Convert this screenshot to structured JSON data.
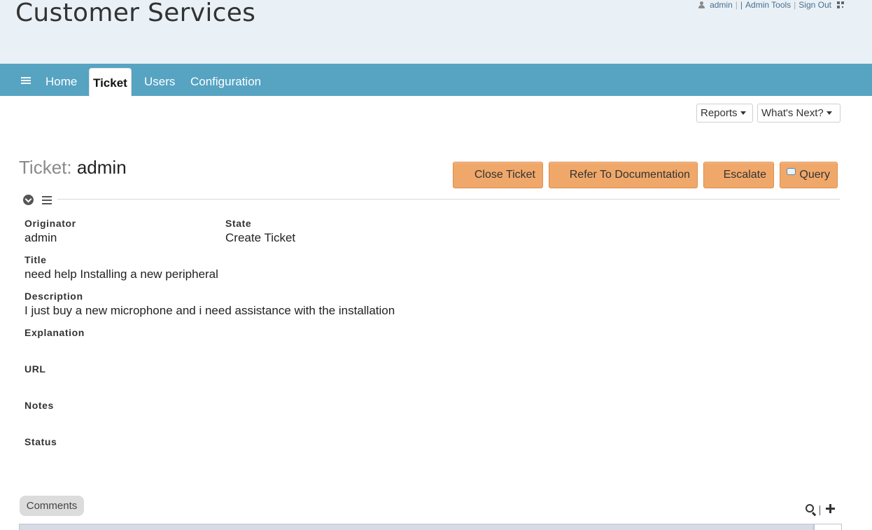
{
  "header": {
    "app_title": "Customer Services",
    "user": "admin",
    "separator": "|",
    "empty_link": "|",
    "admin_tools": "Admin Tools",
    "sign_out": "Sign Out"
  },
  "nav": {
    "items": [
      {
        "label": "Home",
        "active": false
      },
      {
        "label": "Ticket",
        "active": true
      },
      {
        "label": "Users",
        "active": false
      },
      {
        "label": "Configuration",
        "active": false
      }
    ]
  },
  "toolbar": {
    "reports": "Reports",
    "whats_next": "What's Next?"
  },
  "ticket": {
    "heading_label": "Ticket:",
    "heading_value": "admin",
    "actions": {
      "close": "Close Ticket",
      "refer": "Refer To Documentation",
      "escalate": "Escalate",
      "query": "Query"
    },
    "fields": {
      "originator": {
        "label": "Originator",
        "value": "admin"
      },
      "state": {
        "label": "State",
        "value": "Create Ticket"
      },
      "title": {
        "label": "Title",
        "value": "need help Installing a new peripheral"
      },
      "description": {
        "label": "Description",
        "value": "I just buy a new microphone and i need assistance with the installation"
      },
      "explanation": {
        "label": "Explanation",
        "value": ""
      },
      "url": {
        "label": "URL",
        "value": ""
      },
      "notes": {
        "label": "Notes",
        "value": ""
      },
      "status": {
        "label": "Status",
        "value": ""
      }
    }
  },
  "comments": {
    "tab_label": "Comments"
  },
  "colors": {
    "navbar": "#56a3c2",
    "header_bg": "#e9f1f7",
    "action_button": "#f0a86a"
  },
  "icons": [
    "person-icon",
    "qr-code-icon",
    "hamburger-menu-icon",
    "caret-down-icon",
    "chevron-circle-down-icon",
    "list-icon",
    "speech-bubble-icon",
    "search-icon",
    "plus-icon"
  ]
}
